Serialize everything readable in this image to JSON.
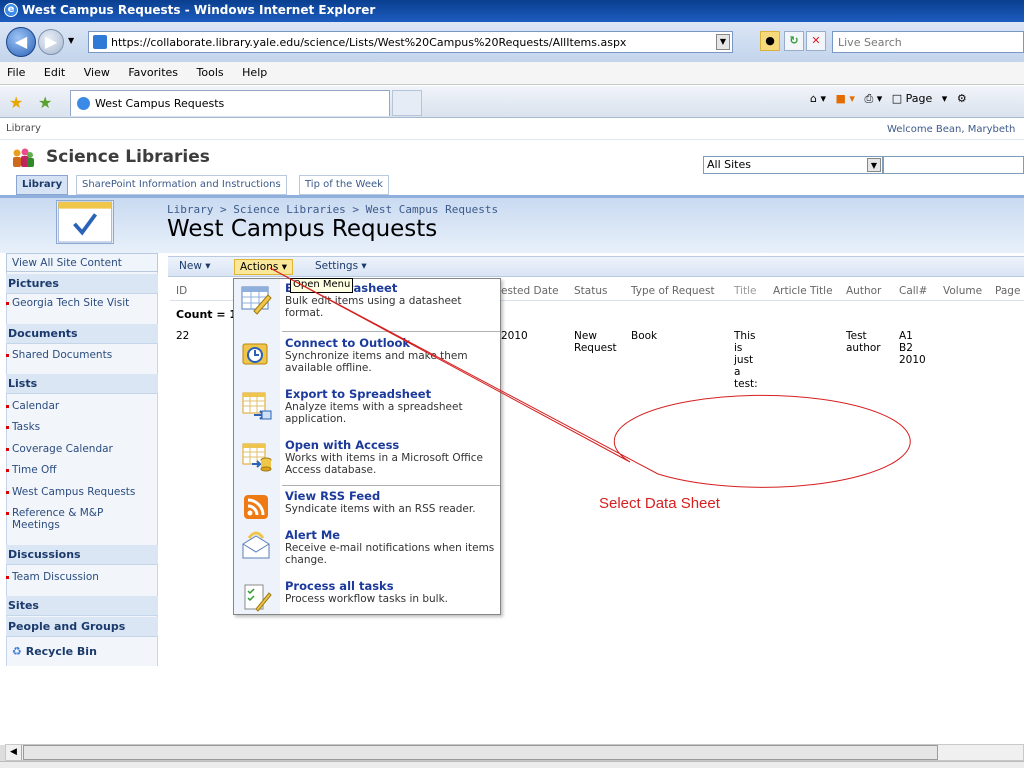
{
  "browser": {
    "window_title": "West Campus Requests - Windows Internet Explorer",
    "url": "https://collaborate.library.yale.edu/science/Lists/West%20Campus%20Requests/AllItems.aspx",
    "search_placeholder": "Live Search",
    "menu": [
      "File",
      "Edit",
      "View",
      "Favorites",
      "Tools",
      "Help"
    ],
    "tab_title": "West Campus Requests",
    "command_page": "Page"
  },
  "sharepoint": {
    "top_link": "Library",
    "welcome": "Welcome Bean, Marybeth",
    "site_title": "Science Libraries",
    "search_scope": "All Sites",
    "top_nav": [
      "Library",
      "SharePoint Information and Instructions",
      "Tip of the Week"
    ],
    "breadcrumb": "Library > Science Libraries > West Campus Requests",
    "page_title": "West Campus Requests"
  },
  "quick_launch": {
    "view_all": "View All Site Content",
    "pictures": "Pictures",
    "pictures_items": [
      "Georgia Tech Site Visit"
    ],
    "documents": "Documents",
    "documents_items": [
      "Shared Documents"
    ],
    "lists": "Lists",
    "lists_items": [
      "Calendar",
      "Tasks",
      "Coverage Calendar",
      "Time Off",
      "West Campus Requests",
      "Reference & M&P Meetings"
    ],
    "discussions": "Discussions",
    "discussions_items": [
      "Team Discussion"
    ],
    "sites": "Sites",
    "people": "People and Groups",
    "recycle": "Recycle Bin"
  },
  "toolbar": {
    "new": "New",
    "actions": "Actions",
    "settings": "Settings",
    "tooltip": "Open Menu"
  },
  "list": {
    "columns": [
      "ID",
      "ested Date",
      "Status",
      "Type of Request",
      "Title",
      "Article Title",
      "Author",
      "Call#",
      "Volume",
      "Page"
    ],
    "count_label": "Count = 1",
    "row": {
      "id": "22",
      "date": "2010",
      "status": "New Request",
      "type": "Book",
      "title": "This is just a test:",
      "author": "Test author",
      "call": "A1 B2 2010"
    }
  },
  "actions_menu": [
    {
      "title": "Edit in Datasheet",
      "desc": "Bulk edit items using a datasheet format.",
      "icon": "datasheet-icon"
    },
    {
      "title": "Connect to Outlook",
      "desc": "Synchronize items and make them available offline.",
      "icon": "outlook-icon"
    },
    {
      "title": "Export to Spreadsheet",
      "desc": "Analyze items with a spreadsheet application.",
      "icon": "spreadsheet-icon"
    },
    {
      "title": "Open with Access",
      "desc": "Works with items in a Microsoft Office Access database.",
      "icon": "access-icon"
    },
    {
      "title": "View RSS Feed",
      "desc": "Syndicate items with an RSS reader.",
      "icon": "rss-icon"
    },
    {
      "title": "Alert Me",
      "desc": "Receive e-mail notifications when items change.",
      "icon": "alert-icon"
    },
    {
      "title": "Process all tasks",
      "desc": "Process workflow tasks in bulk.",
      "icon": "tasks-icon"
    }
  ],
  "callout": {
    "text": "Select Data Sheet",
    "color": "#d61f1f"
  }
}
